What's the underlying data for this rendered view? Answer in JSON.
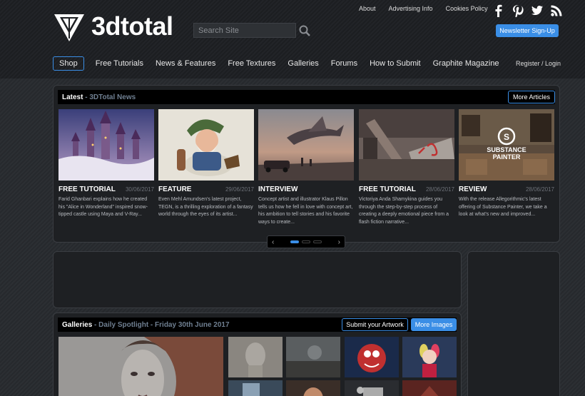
{
  "header": {
    "logo_text": "3dtotal",
    "search_placeholder": "Search Site",
    "toplinks": [
      "About",
      "Advertising Info",
      "Cookies Policy"
    ],
    "social_icons": [
      "facebook-icon",
      "pinterest-icon",
      "twitter-icon",
      "rss-icon"
    ],
    "newsletter_label": "Newsletter Sign-Up",
    "login_label": "Register / Login"
  },
  "nav": {
    "items": [
      "Shop",
      "Free Tutorials",
      "News & Features",
      "Free Textures",
      "Galleries",
      "Forums",
      "How to Submit",
      "Graphite Magazine"
    ]
  },
  "latest": {
    "title": "Latest",
    "subtitle": "3DTotal News",
    "more_label": "More Articles",
    "articles": [
      {
        "category": "FREE TUTORIAL",
        "date": "30/06/2017",
        "desc": "Farid Ghanbari explains how he created his \"Alice in Wonderland\" inspired snow-tipped castle using Maya and V-Ray..."
      },
      {
        "category": "FEATURE",
        "date": "29/06/2017",
        "desc": "Even Mehl Amundsen's latest project, TEGN, is a thrilling exploration of a fantasy world through the eyes of its artist..."
      },
      {
        "category": "INTERVIEW",
        "date": "29/06/2017",
        "desc": "Concept artist and illustrator Klaus Pillon tells us how he fell in love with concept art, his ambition to tell stories and his favorite ways to create..."
      },
      {
        "category": "FREE TUTORIAL",
        "date": "28/06/2017",
        "desc": "Victoriya Anda Shamykina guides you through the step-by-step process of creating a deeply emotional piece from a flash fiction narrative..."
      },
      {
        "category": "REVIEW",
        "date": "28/06/2017",
        "desc": "With the release Allegorithmic's latest offering of Substance Painter, we take a look at what's new and improved..."
      }
    ],
    "review_logo_text": "SUBSTANCE PAINTER"
  },
  "pager": {
    "left": "‹",
    "right": "›",
    "active_index": 0
  },
  "galleries": {
    "title": "Galleries",
    "subtitle": "Daily Spotlight - Friday 30th June 2017",
    "submit_label": "Submit your Artwork",
    "more_label": "More Images"
  },
  "colors": {
    "accent": "#3a8ee6",
    "panel": "#1e2023",
    "header_bg": "#1f2124"
  }
}
